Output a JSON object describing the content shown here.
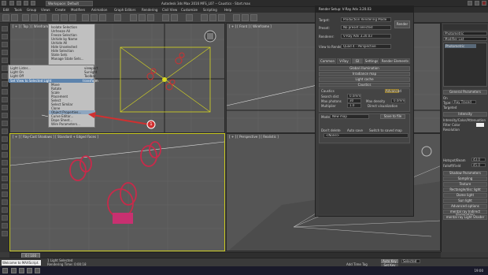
{
  "window": {
    "title": "Autodesk 3ds Max 2016    MFS_L07 -- Caustics - Start.max",
    "workspace": "Workspace: Default"
  },
  "menus": [
    "Edit",
    "Tools",
    "Group",
    "Views",
    "Create",
    "Modifiers",
    "Animation",
    "Graph Editors",
    "Rendering",
    "Civil View",
    "Customize",
    "Scripting",
    "Help"
  ],
  "viewports": {
    "top": "[ + ] [ Top ] [ Wireframe ]",
    "front": "[ + ] [ Front ] [ Wireframe ]",
    "left": "[ + ] [ Ray-Cast Shadows ] [ Standard + Edged Faces ]",
    "perspective": "[ + ] [ Perspective ] [ Realistic ]"
  },
  "context_menu": {
    "top_items": [
      "Isolate Selection",
      "Unfreeze All",
      "Freeze Selection",
      "Unhide by Name",
      "Unhide All",
      "Hide Unselected",
      "Hide Selection",
      "State Sets",
      "Manage State Sets..."
    ],
    "lower_items": [
      "Move",
      "Rotate",
      "Scale",
      "Placement",
      "Select",
      "Select Similar",
      "Clone",
      "Object Properties...",
      "Curve Editor...",
      "Dope Sheet...",
      "Wire Parameters...",
      "Convert To:",
      "V-Ray properties",
      "V-Ray VFB"
    ],
    "highlighted": "Object Properties...",
    "submenu": [
      "Light Lister...",
      "Light On",
      "Light Off",
      "Set View to Selected Light"
    ],
    "submenu_highlighted": "Set View to Selected Light",
    "submenu_right": [
      "viewport",
      "Sunlight",
      "Toolbar",
      "transform"
    ]
  },
  "annotation": {
    "number": "1"
  },
  "render_dialog": {
    "title": "Render Setup: V-Ray Adv 3.20.03",
    "target_label": "Target:",
    "target_value": "Production Rendering Mode",
    "preset_label": "Preset:",
    "preset_value": "No preset selected",
    "renderer_label": "Renderer:",
    "renderer_value": "V-Ray Adv 3.20.03",
    "view_label": "View to Render:",
    "view_value": "Quad 4 - Perspective",
    "render_btn": "Render",
    "tabs": [
      "Common",
      "V-Ray",
      "GI",
      "Settings",
      "Render Elements"
    ],
    "rollouts": [
      "Global illumination",
      "Irradiance map",
      "Light cache",
      "Caustics"
    ],
    "caustics_label": "Caustics",
    "advanced": "Advanced",
    "fields": [
      {
        "label": "Search dist",
        "value": "0.0mm"
      },
      {
        "label": "Max photons",
        "value": "30"
      },
      {
        "label": "Multiplier",
        "value": "1.0"
      },
      {
        "label": "Max density",
        "value": "0.0mm"
      }
    ],
    "direct_vis": "Direct visualization",
    "mode_label": "Mode",
    "mode_value": "New map",
    "save_to_file": "Save to file",
    "dont_delete": "Don't delete",
    "auto_save": "Auto save",
    "switch_saved": "Switch to saved map",
    "none": "<None>"
  },
  "right_panel": {
    "name": "Photometric",
    "modifier_list": "Modifier List",
    "general": "General Parameters",
    "on": "On",
    "targeted": "Targeted",
    "type_label": "Type:",
    "type_value": "Ray Traced",
    "intensity": "Intensity",
    "color_rollout": "Intensity/Color/Attenuation",
    "filter": "Filter Color",
    "resolution": "Resolution",
    "sections": [
      "Shadow Parameters",
      "Sampling",
      "Texture",
      "Rectangle/disc light",
      "Dome light",
      "Sun light",
      "Advanced options",
      "mental ray Indirect Illumination",
      "mental ray Light Shader"
    ],
    "hotspot_label": "Hotspot/Beam",
    "hotspot_value": "43.0",
    "falloff_label": "Falloff/Field",
    "falloff_value": "45.0"
  },
  "timeline": {
    "frame": "0 / 100"
  },
  "status": {
    "welcome": "Welcome to MAXScript.",
    "selected": "1 Light Selected",
    "rendering": "Rendering Time: 0:00:18",
    "addtime": "Add Time Tag",
    "keymode": "Selected",
    "autokey": "Auto Key",
    "setkey": "Set Key"
  },
  "clock": "19:00"
}
